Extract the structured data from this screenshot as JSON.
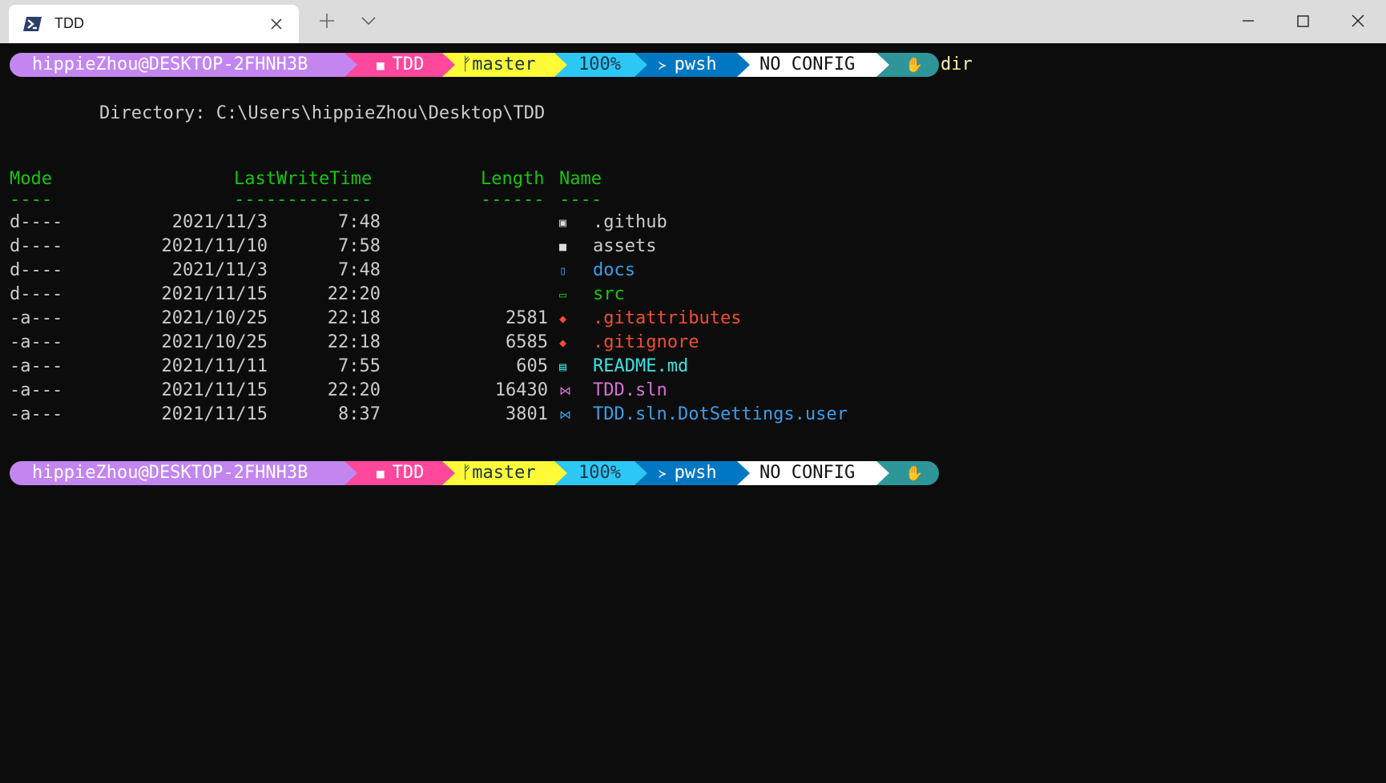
{
  "window": {
    "tab_title": "TDD",
    "new_tab_icon": "plus-icon",
    "dropdown_icon": "chevron-down-icon",
    "minimize_icon": "minimize-icon",
    "maximize_icon": "maximize-icon",
    "close_icon": "close-icon"
  },
  "prompt": {
    "user": "hippieZhou@DESKTOP-2FHNH3B",
    "path": "TDD",
    "git_branch": "master",
    "battery": "100%",
    "shell": "pwsh",
    "config": "NO CONFIG"
  },
  "command": "dir",
  "directory_line": "Directory: C:\\Users\\hippieZhou\\Desktop\\TDD",
  "headers": {
    "mode": "Mode",
    "mode_rule": "----",
    "lwt": "LastWriteTime",
    "lwt_rule": "-------------",
    "length": "Length",
    "length_rule": "------",
    "name": "Name",
    "name_rule": "----"
  },
  "rows": [
    {
      "mode": "d----",
      "date": "2021/11/3",
      "time": "7:48",
      "length": "",
      "name": ".github",
      "icon": "github-folder-icon",
      "color": "#cccccc"
    },
    {
      "mode": "d----",
      "date": "2021/11/10",
      "time": "7:58",
      "length": "",
      "name": "assets",
      "icon": "folder-icon",
      "color": "#cccccc"
    },
    {
      "mode": "d----",
      "date": "2021/11/3",
      "time": "7:48",
      "length": "",
      "name": "docs",
      "icon": "book-icon",
      "color": "#3b9ee8"
    },
    {
      "mode": "d----",
      "date": "2021/11/15",
      "time": "22:20",
      "length": "",
      "name": "src",
      "icon": "terminal-icon",
      "color": "#16c60c"
    },
    {
      "mode": "-a---",
      "date": "2021/10/25",
      "time": "22:18",
      "length": "2581",
      "name": ".gitattributes",
      "icon": "git-icon",
      "color": "#f14e32"
    },
    {
      "mode": "-a---",
      "date": "2021/10/25",
      "time": "22:18",
      "length": "6585",
      "name": ".gitignore",
      "icon": "git-icon",
      "color": "#f14e32"
    },
    {
      "mode": "-a---",
      "date": "2021/11/11",
      "time": "7:55",
      "length": "605",
      "name": "README.md",
      "icon": "markdown-icon",
      "color": "#3ae4e4"
    },
    {
      "mode": "-a---",
      "date": "2021/11/15",
      "time": "22:20",
      "length": "16430",
      "name": "TDD.sln",
      "icon": "visual-studio-icon",
      "color": "#d670d6"
    },
    {
      "mode": "-a---",
      "date": "2021/11/15",
      "time": "8:37",
      "length": "3801",
      "name": "TDD.sln.DotSettings.user",
      "icon": "vscode-icon",
      "color": "#3b9ee8"
    }
  ]
}
